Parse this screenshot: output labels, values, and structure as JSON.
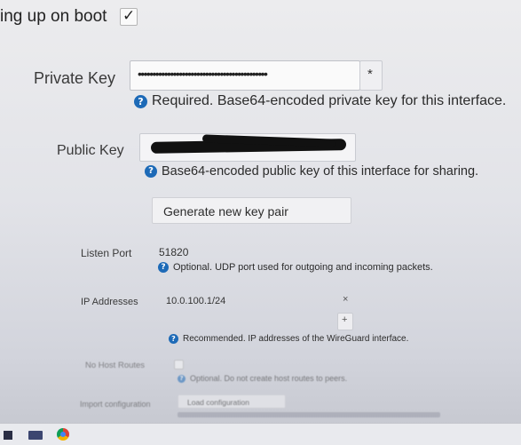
{
  "boot": {
    "label": "ing up on boot",
    "checked": "✓"
  },
  "private_key": {
    "label": "Private Key",
    "value": "••••••••••••••••••••••••••••••••••••••••••••",
    "required_marker": "*",
    "hint": "Required. Base64-encoded private key for this interface."
  },
  "public_key": {
    "label": "Public Key",
    "hint": "Base64-encoded public key of this interface for sharing."
  },
  "generate_button": "Generate new key pair",
  "listen_port": {
    "label": "Listen Port",
    "value": "51820",
    "hint": "Optional. UDP port used for outgoing and incoming packets."
  },
  "ip_addresses": {
    "label": "IP Addresses",
    "value": "10.0.100.1/24",
    "remove": "×",
    "add": "+",
    "hint": "Recommended. IP addresses of the WireGuard interface."
  },
  "no_host_routes": {
    "label": "No Host Routes",
    "hint": "Optional. Do not create host routes to peers."
  },
  "import_configuration": {
    "label": "Import configuration",
    "button": "Load configuration"
  },
  "colors": {
    "hint_icon": "#1d6ab7",
    "background": "#e6e7eb",
    "redaction": "#111111"
  }
}
